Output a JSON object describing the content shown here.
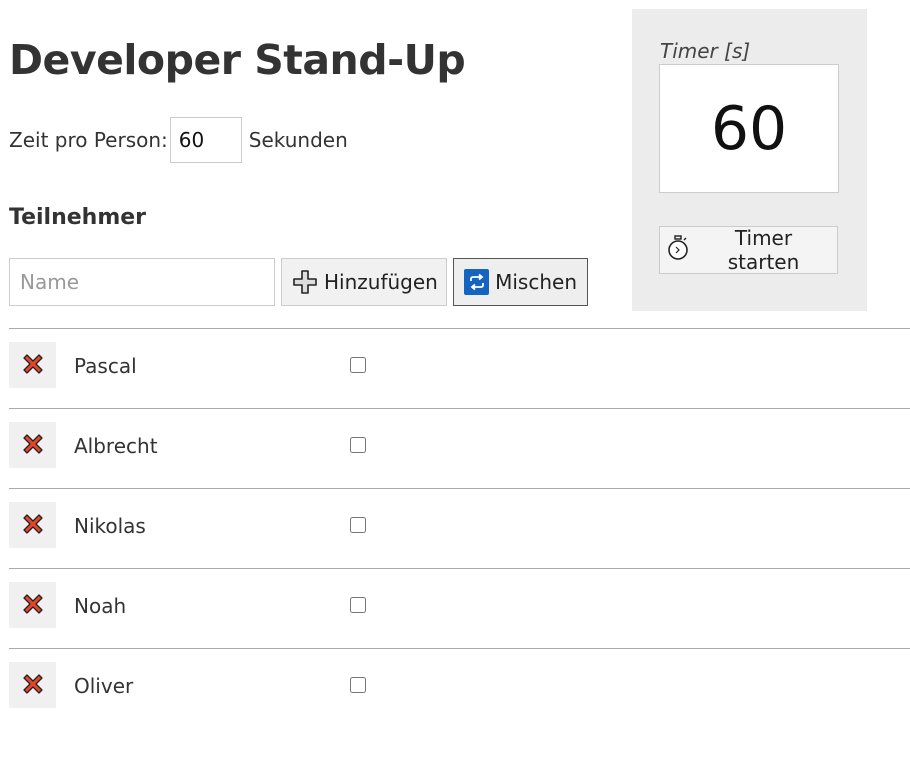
{
  "page": {
    "title": "Developer Stand-Up"
  },
  "settings": {
    "time_label": "Zeit pro Person:",
    "time_value": "60",
    "time_unit": "Sekunden"
  },
  "participants_section": {
    "heading": "Teilnehmer",
    "name_placeholder": "Name",
    "add_label": "Hinzufügen",
    "shuffle_label": "Mischen"
  },
  "timer": {
    "label": "Timer [s]",
    "value": "60",
    "start_label": "Timer starten"
  },
  "participants": [
    {
      "name": "Pascal",
      "done": false
    },
    {
      "name": "Albrecht",
      "done": false
    },
    {
      "name": "Nikolas",
      "done": false
    },
    {
      "name": "Noah",
      "done": false
    },
    {
      "name": "Oliver",
      "done": false
    }
  ],
  "icons": {
    "add": "plus-icon",
    "shuffle": "shuffle-icon",
    "timer": "stopwatch-icon",
    "delete": "delete-x-icon"
  },
  "colors": {
    "delete_red": "#e8432b",
    "shuffle_blue": "#1565c0",
    "panel_bg": "#ececec"
  }
}
